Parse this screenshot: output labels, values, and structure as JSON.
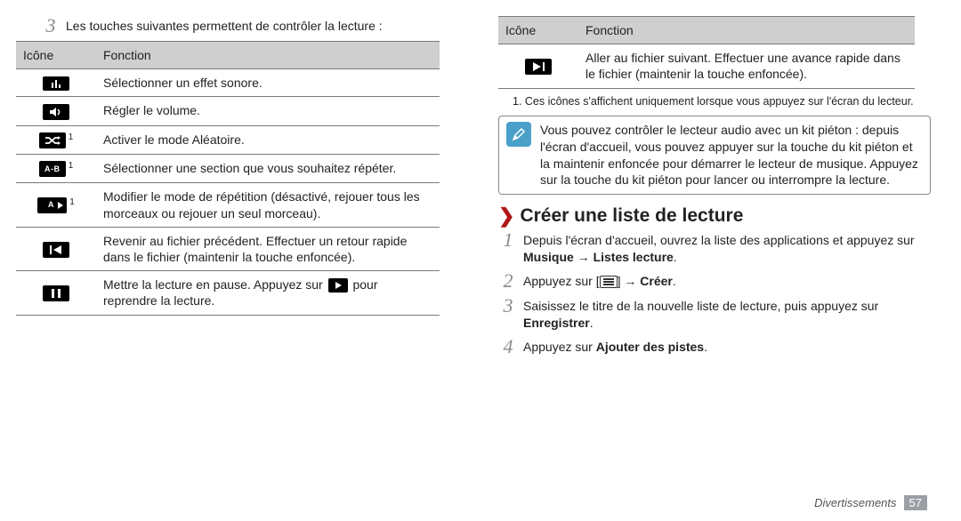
{
  "leftStep3Intro": "Les touches suivantes permettent de contrôler la lecture :",
  "tableHeaders": {
    "icon": "Icône",
    "function": "Fonction"
  },
  "leftTable": [
    {
      "func": "Sélectionner un effet sonore."
    },
    {
      "func": "Régler le volume."
    },
    {
      "func": "Activer le mode Aléatoire.",
      "sup": "1"
    },
    {
      "func": "Sélectionner une section que vous souhaitez répéter.",
      "sup": "1",
      "label": "A-B"
    },
    {
      "func": "Modifier le mode de répétition (désactivé, rejouer tous les morceaux ou rejouer un seul morceau).",
      "sup": "1",
      "label": "A"
    },
    {
      "func": "Revenir au fichier précédent. Effectuer un retour rapide dans le fichier (maintenir la touche enfoncée)."
    },
    {
      "funcA": "Mettre la lecture en pause. Appuyez sur ",
      "funcB": " pour reprendre la lecture."
    }
  ],
  "rightTable": [
    {
      "func": "Aller au fichier suivant. Effectuer une avance rapide dans le fichier (maintenir la touche enfoncée)."
    }
  ],
  "footnote": "1. Ces icônes s'affichent uniquement lorsque vous appuyez sur l'écran du lecteur.",
  "infobox": "Vous pouvez contrôler le lecteur audio avec un kit piéton : depuis l'écran d'accueil, vous pouvez appuyer sur la touche du kit piéton et la maintenir enfoncée pour démarrer le lecteur de musique. Appuyez sur la touche du kit piéton pour lancer ou interrompre la lecture.",
  "sectionHeader": "Créer une liste de lecture",
  "steps": [
    {
      "num": "1",
      "aText": "Depuis l'écran d'accueil, ouvrez la liste des applications et appuyez sur ",
      "b1": "Musique",
      "arrow": " → ",
      "b2": "Listes lecture",
      "tail": "."
    },
    {
      "num": "2",
      "aText": "Appuyez sur [",
      "menuIcon": true,
      "bText": "] → ",
      "b1": "Créer",
      "tail": "."
    },
    {
      "num": "3",
      "aText": "Saisissez le titre de la nouvelle liste de lecture, puis appuyez sur ",
      "b1": "Enregistrer",
      "tail": "."
    },
    {
      "num": "4",
      "aText": "Appuyez sur ",
      "b1": "Ajouter des pistes",
      "tail": "."
    }
  ],
  "footer": {
    "section": "Divertissements",
    "page": "57"
  }
}
